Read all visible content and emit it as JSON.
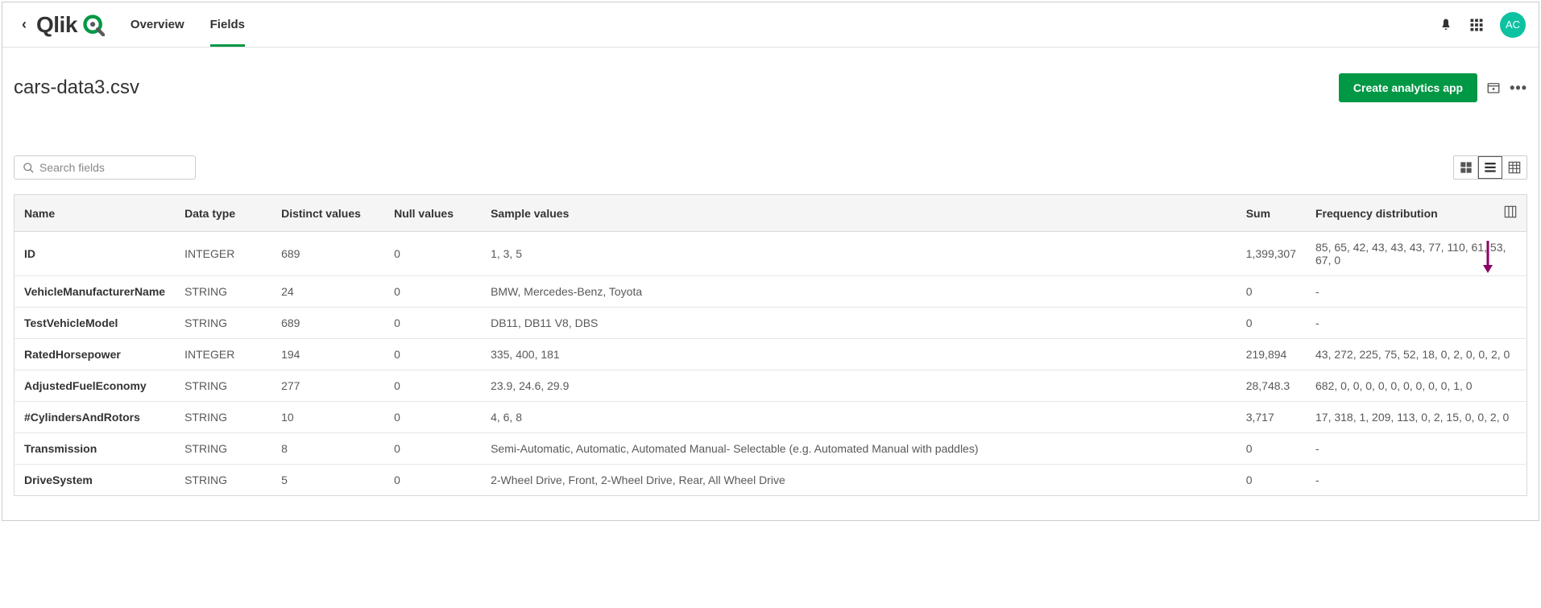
{
  "nav": {
    "back": "‹",
    "brand": "Qlik",
    "tabs": {
      "overview": "Overview",
      "fields": "Fields"
    },
    "avatar": "AC"
  },
  "header": {
    "title": "cars-data3.csv",
    "create_button": "Create analytics app"
  },
  "search": {
    "placeholder": "Search fields"
  },
  "table": {
    "headers": {
      "name": "Name",
      "data_type": "Data type",
      "distinct": "Distinct values",
      "null": "Null values",
      "sample": "Sample values",
      "sum": "Sum",
      "freq": "Frequency distribution"
    },
    "rows": [
      {
        "name": "ID",
        "data_type": "INTEGER",
        "distinct": "689",
        "null": "0",
        "sample": "1, 3, 5",
        "sum": "1,399,307",
        "freq": "85, 65, 42, 43, 43, 43, 77, 110, 61, 53, 67, 0"
      },
      {
        "name": "VehicleManufacturerName",
        "data_type": "STRING",
        "distinct": "24",
        "null": "0",
        "sample": "BMW, Mercedes-Benz, Toyota",
        "sum": "0",
        "freq": "-"
      },
      {
        "name": "TestVehicleModel",
        "data_type": "STRING",
        "distinct": "689",
        "null": "0",
        "sample": "DB11, DB11 V8, DBS",
        "sum": "0",
        "freq": "-"
      },
      {
        "name": "RatedHorsepower",
        "data_type": "INTEGER",
        "distinct": "194",
        "null": "0",
        "sample": "335, 400, 181",
        "sum": "219,894",
        "freq": "43, 272, 225, 75, 52, 18, 0, 2, 0, 0, 2, 0"
      },
      {
        "name": "AdjustedFuelEconomy",
        "data_type": "STRING",
        "distinct": "277",
        "null": "0",
        "sample": "23.9, 24.6, 29.9",
        "sum": "28,748.3",
        "freq": "682, 0, 0, 0, 0, 0, 0, 0, 0, 0, 1, 0"
      },
      {
        "name": "#CylindersAndRotors",
        "data_type": "STRING",
        "distinct": "10",
        "null": "0",
        "sample": "4, 6, 8",
        "sum": "3,717",
        "freq": "17, 318, 1, 209, 113, 0, 2, 15, 0, 0, 2, 0"
      },
      {
        "name": "Transmission",
        "data_type": "STRING",
        "distinct": "8",
        "null": "0",
        "sample": "Semi-Automatic, Automatic, Automated Manual- Selectable (e.g. Automated Manual with paddles)",
        "sum": "0",
        "freq": "-"
      },
      {
        "name": "DriveSystem",
        "data_type": "STRING",
        "distinct": "5",
        "null": "0",
        "sample": "2-Wheel Drive, Front, 2-Wheel Drive, Rear, All Wheel Drive",
        "sum": "0",
        "freq": "-"
      }
    ]
  }
}
